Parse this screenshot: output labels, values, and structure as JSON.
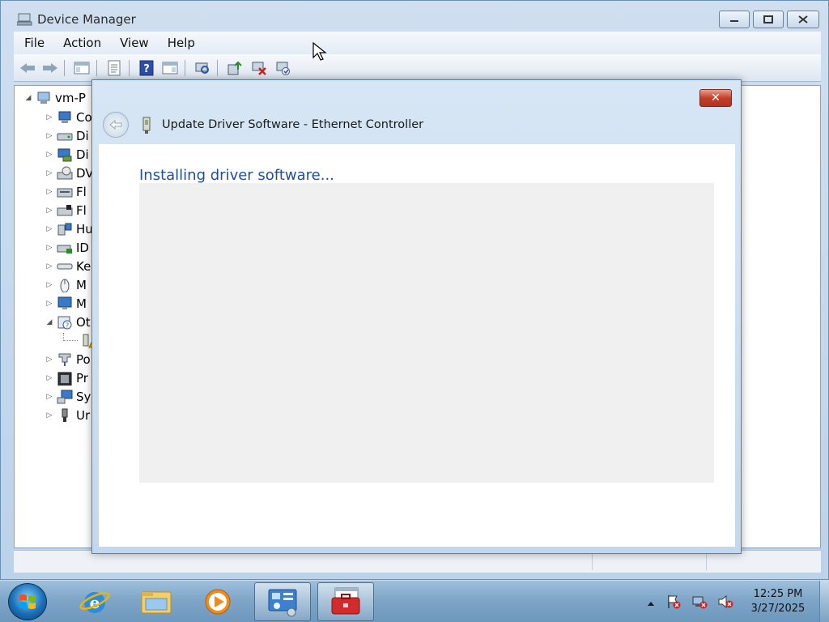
{
  "window": {
    "title": "Device Manager",
    "icon": "device-manager-icon"
  },
  "menu": {
    "items": [
      "File",
      "Action",
      "View",
      "Help"
    ]
  },
  "toolbar": {
    "icons": [
      "back-arrow-icon",
      "forward-arrow-icon",
      "show-hide-tree-icon",
      "properties-icon",
      "help-icon",
      "show-hide-action-pane-icon",
      "scan-hardware-icon",
      "update-driver-icon",
      "disable-device-icon",
      "uninstall-device-icon"
    ]
  },
  "tree": {
    "root_label": "vm-P",
    "items": [
      {
        "label": "Co",
        "icon": "computer-icon"
      },
      {
        "label": "Di",
        "icon": "disk-drive-icon"
      },
      {
        "label": "Di",
        "icon": "display-adapter-icon"
      },
      {
        "label": "DV",
        "icon": "dvd-drive-icon"
      },
      {
        "label": "Fl",
        "icon": "floppy-controller-icon"
      },
      {
        "label": "Fl",
        "icon": "floppy-drive-icon"
      },
      {
        "label": "Hu",
        "icon": "hid-icon"
      },
      {
        "label": "ID",
        "icon": "ide-controller-icon"
      },
      {
        "label": "Ke",
        "icon": "keyboard-icon"
      },
      {
        "label": "M",
        "icon": "mouse-icon"
      },
      {
        "label": "M",
        "icon": "monitor-icon"
      },
      {
        "label": "Ot",
        "icon": "other-devices-icon"
      },
      {
        "label": "",
        "icon": "unknown-device-warning-icon"
      },
      {
        "label": "Po",
        "icon": "ports-icon"
      },
      {
        "label": "Pr",
        "icon": "processor-icon"
      },
      {
        "label": "Sy",
        "icon": "system-devices-icon"
      },
      {
        "label": "Ur",
        "icon": "usb-controller-icon"
      }
    ]
  },
  "dialog": {
    "title": "Update Driver Software - Ethernet Controller",
    "heading": "Installing driver software...",
    "close_glyph": "✕"
  },
  "taskbar": {
    "apps": [
      "internet-explorer-icon",
      "windows-explorer-icon",
      "media-player-icon",
      "control-panel-icon",
      "device-manager-toolbox-icon"
    ],
    "clock_time": "12:25 PM",
    "clock_date": "3/27/2025",
    "tray_icons": [
      "show-hidden-icons-chevron",
      "action-center-icon",
      "network-disconnected-icon",
      "volume-muted-icon"
    ]
  },
  "colors": {
    "accent": "#1f4e9b",
    "close_button": "#c2402b",
    "window_frame": "#bcd2ea"
  }
}
